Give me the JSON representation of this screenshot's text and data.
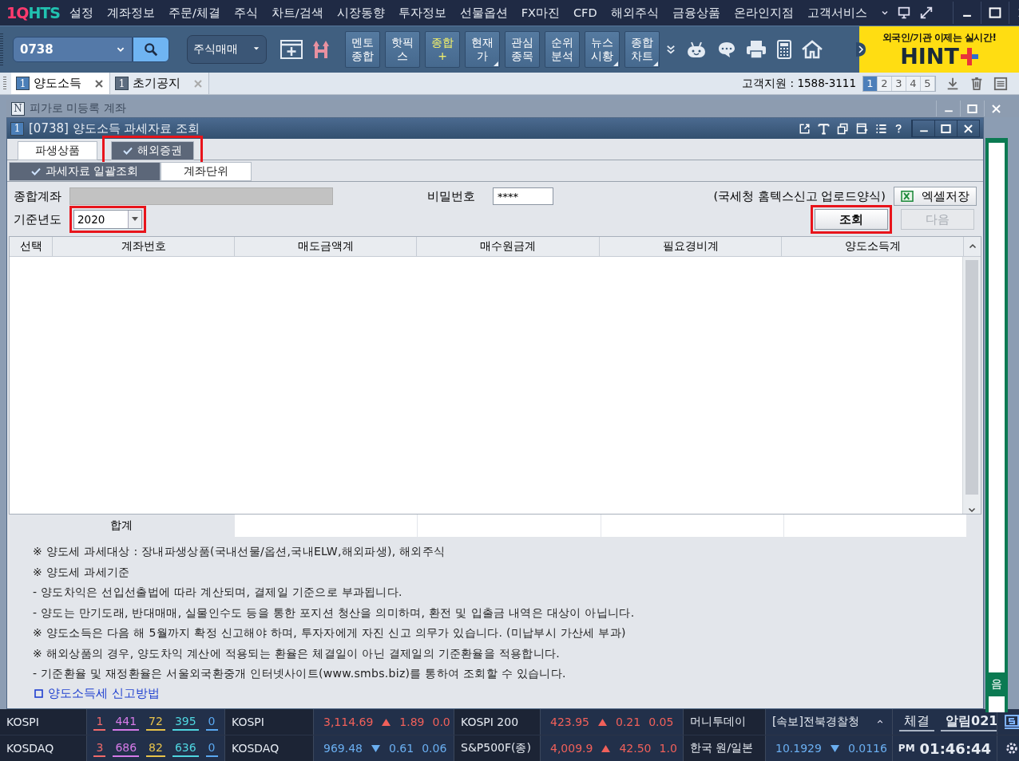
{
  "menu_bar": {
    "logo": {
      "mark": "1Q",
      "text": "HTS"
    },
    "items": [
      "설정",
      "계좌정보",
      "주문/체결",
      "주식",
      "차트/검색",
      "시장동향",
      "투자정보",
      "선물옵션",
      "FX마진",
      "CFD",
      "해외주식",
      "금융상품",
      "온라인지점",
      "고객서비스"
    ]
  },
  "toolbar": {
    "code_field": {
      "value": "0738"
    },
    "order_select": {
      "value": "주식매매"
    },
    "shortcuts": [
      {
        "lines": [
          "멘토",
          "종합"
        ],
        "accent": false,
        "has_menu": false
      },
      {
        "lines": [
          "핫픽",
          "스"
        ],
        "accent": false,
        "has_menu": false
      },
      {
        "lines": [
          "종합",
          "+"
        ],
        "accent": true,
        "has_menu": false
      },
      {
        "lines": [
          "현재",
          "가"
        ],
        "accent": false,
        "has_menu": true
      },
      {
        "lines": [
          "관심",
          "종목"
        ],
        "accent": false,
        "has_menu": false
      },
      {
        "lines": [
          "순위",
          "분석"
        ],
        "accent": false,
        "has_menu": false
      },
      {
        "lines": [
          "뉴스",
          "시황"
        ],
        "accent": false,
        "has_menu": true
      },
      {
        "lines": [
          "종합",
          "차트"
        ],
        "accent": false,
        "has_menu": true
      }
    ],
    "ad": {
      "headline": "외국인/기관 이제는 실시간!",
      "brand": "HINT"
    }
  },
  "tab_bar": {
    "tabs": [
      {
        "badge": "1",
        "label": "양도소득",
        "selected": true
      },
      {
        "badge": "1",
        "label": "초기공지",
        "selected": false
      }
    ],
    "support": "고객지원 : 1588-3111",
    "pages": [
      {
        "label": "1",
        "selected": true
      },
      {
        "label": "2",
        "selected": false
      },
      {
        "label": "3",
        "selected": false
      },
      {
        "label": "4",
        "selected": false
      },
      {
        "label": "5",
        "selected": false
      }
    ]
  },
  "background_window": {
    "badge": "N",
    "title": "피가로 미등록 계좌",
    "side_text": "음"
  },
  "window": {
    "badge": "1",
    "title": "[0738] 양도소득 과세자료 조회",
    "product_tabs": [
      {
        "label": "파생상품",
        "selected": false,
        "highlighted": false
      },
      {
        "label": "해외증권",
        "selected": true,
        "highlighted": true
      }
    ],
    "view_tabs": [
      {
        "label": "과세자료 일괄조회",
        "selected": true
      },
      {
        "label": "계좌단위",
        "selected": false
      }
    ],
    "form": {
      "account_label": "종합계좌",
      "password_label": "비밀번호",
      "password_value": "****",
      "upload_note": "(국세청 홈텍스신고 업로드양식)",
      "excel_button": "엑셀저장",
      "year_label": "기준년도",
      "year_value": "2020",
      "year_highlighted": true,
      "buttons": [
        {
          "label": "조회",
          "disabled": false,
          "highlighted": true
        },
        {
          "label": "다음",
          "disabled": true,
          "highlighted": false
        }
      ]
    },
    "table": {
      "columns": [
        "선택",
        "계좌번호",
        "매도금액계",
        "매수원금계",
        "필요경비계",
        "양도소득계"
      ],
      "total_label": "합계"
    },
    "notes": [
      "※ 양도세 과세대상 : 장내파생상품(국내선물/옵션,국내ELW,해외파생), 해외주식",
      "※ 양도세 과세기준",
      "- 양도차익은 선입선출법에 따라 계산되며, 결제일 기준으로 부과됩니다.",
      "- 양도는 만기도래, 반대매매, 실물인수도 등을 통한 포지션 청산을 의미하며, 환전 및 입출금 내역은 대상이 아닙니다.",
      "※ 양도소득은 다음 해 5월까지 확정 신고해야 하며, 투자자에게 자진 신고 의무가 있습니다. (미납부시 가산세 부과)",
      "※ 해외상품의 경우, 양도차익 계산에 적용되는 환율은 체결일이 아닌 결제일의 기준환율을 적용합니다.",
      "- 기준환율 및 재정환율은 서울외국환중개 인터넷사이트(www.smbs.biz)를 통하여 조회할 수 있습니다."
    ],
    "link": "양도소득세 신고방법"
  },
  "ticker": {
    "rows": [
      {
        "index_name": "KOSPI",
        "breadth": [
          {
            "value": "1",
            "color": "#f06a6a"
          },
          {
            "value": "441",
            "color": "#d67ae8"
          },
          {
            "value": "72",
            "color": "#e8c34a"
          },
          {
            "value": "395",
            "color": "#4fd6e0"
          },
          {
            "value": "0",
            "color": "#5aa8f0"
          }
        ],
        "quotes": [
          {
            "name": "KOSPI",
            "price": "3,114.69",
            "rising": true,
            "change": "1.89",
            "rate": "0.0"
          },
          {
            "name": "KOSPI 200",
            "price": "423.95",
            "rising": true,
            "change": "0.21",
            "rate": "0.05"
          }
        ],
        "info": {
          "kind": "news",
          "source": "머니투데이",
          "headline": "[속보]전북경찰청"
        },
        "tail": {
          "kind": "alerts",
          "items": [
            "체결",
            "알림021"
          ]
        }
      },
      {
        "index_name": "KOSDAQ",
        "breadth": [
          {
            "value": "3",
            "color": "#f06a6a"
          },
          {
            "value": "686",
            "color": "#d67ae8"
          },
          {
            "value": "82",
            "color": "#e8c34a"
          },
          {
            "value": "636",
            "color": "#4fd6e0"
          },
          {
            "value": "0",
            "color": "#5aa8f0"
          }
        ],
        "quotes": [
          {
            "name": "KOSDAQ",
            "price": "969.48",
            "rising": false,
            "change": "0.61",
            "rate": "0.06"
          },
          {
            "name": "S&P500F(종)",
            "price": "4,009.9",
            "rising": true,
            "change": "42.50",
            "rate": "1.0"
          }
        ],
        "info": {
          "kind": "fx",
          "name": "한국 원/일본",
          "price": "10.1929",
          "rising": false,
          "change": "0.0116"
        },
        "tail": {
          "kind": "clock",
          "meridiem": "PM",
          "time": "01:46:44"
        }
      }
    ]
  }
}
